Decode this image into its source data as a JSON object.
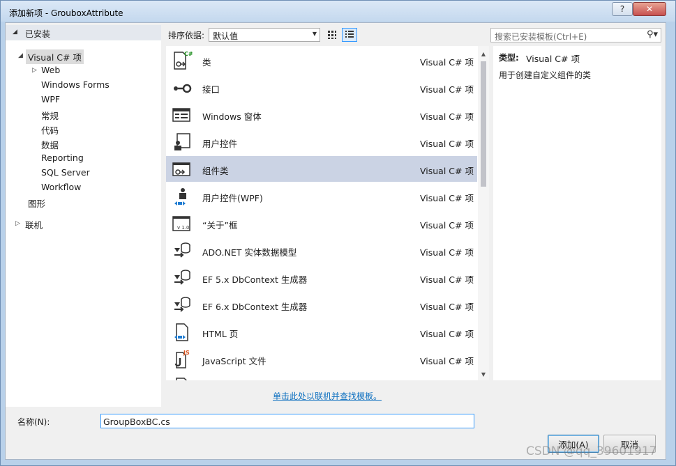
{
  "window": {
    "title": "添加新项 - GrouboxAttribute",
    "help_label": "?",
    "close_label": "✕"
  },
  "tree": {
    "installed_label": "已安装",
    "root_label": "Visual C# 项",
    "children": [
      "Web",
      "Windows Forms",
      "WPF",
      "常规",
      "代码",
      "数据",
      "Reporting",
      "SQL Server",
      "Workflow"
    ],
    "graphics_label": "图形",
    "online_label": "联机"
  },
  "toolbar": {
    "sort_label": "排序依据:",
    "sort_value": "默认值",
    "search_placeholder": "搜索已安装模板(Ctrl+E)"
  },
  "templates": [
    {
      "name": "类",
      "type": "Visual C# 项",
      "icon": "class-icon"
    },
    {
      "name": "接口",
      "type": "Visual C# 项",
      "icon": "interface-icon"
    },
    {
      "name": "Windows 窗体",
      "type": "Visual C# 项",
      "icon": "windows-form-icon"
    },
    {
      "name": "用户控件",
      "type": "Visual C# 项",
      "icon": "user-control-icon"
    },
    {
      "name": "组件类",
      "type": "Visual C# 项",
      "icon": "component-class-icon",
      "selected": true
    },
    {
      "name": "用户控件(WPF)",
      "type": "Visual C# 项",
      "icon": "wpf-user-control-icon"
    },
    {
      "name": "“关于”框",
      "type": "Visual C# 项",
      "icon": "about-box-icon"
    },
    {
      "name": "ADO.NET 实体数据模型",
      "type": "Visual C# 项",
      "icon": "data-model-icon"
    },
    {
      "name": "EF 5.x DbContext 生成器",
      "type": "Visual C# 项",
      "icon": "data-model-icon"
    },
    {
      "name": "EF 6.x DbContext 生成器",
      "type": "Visual C# 项",
      "icon": "data-model-icon"
    },
    {
      "name": "HTML 页",
      "type": "Visual C# 项",
      "icon": "html-page-icon"
    },
    {
      "name": "JavaScript 文件",
      "type": "Visual C# 项",
      "icon": "javascript-file-icon"
    }
  ],
  "details": {
    "type_label": "类型:",
    "type_value": "Visual C# 项",
    "description": "用于创建自定义组件的类"
  },
  "online_link": "单击此处以联机并查找模板。",
  "name_field": {
    "label": "名称(N):",
    "value": "GroupBoxBC.cs"
  },
  "buttons": {
    "add": "添加(A)",
    "cancel": "取消"
  },
  "watermark": "CSDN @qq_39601917",
  "colors": {
    "selection": "#cbd3e4",
    "link": "#0e70c0",
    "focus_border": "#3399ff"
  }
}
